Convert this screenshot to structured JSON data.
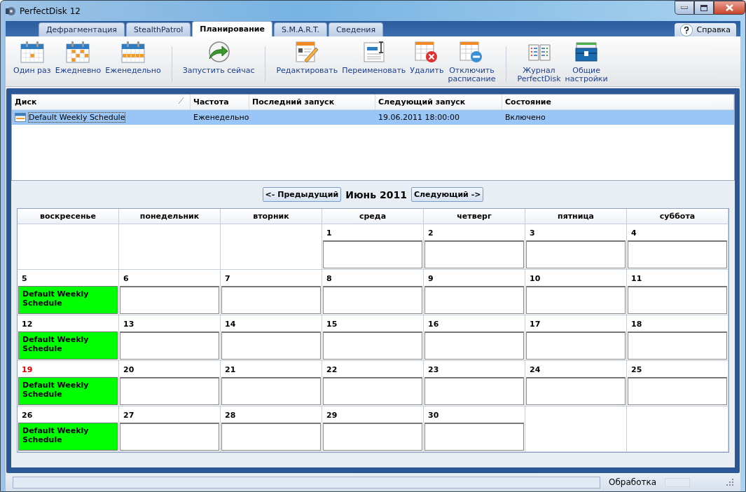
{
  "window": {
    "title": "PerfectDisk 12"
  },
  "tabs": [
    {
      "label": "Дефрагментация",
      "selected": false
    },
    {
      "label": "StealthPatrol",
      "selected": false
    },
    {
      "label": "Планирование",
      "selected": true
    },
    {
      "label": "S.M.A.R.T.",
      "selected": false
    },
    {
      "label": "Сведения",
      "selected": false
    }
  ],
  "help": {
    "label": "Справка"
  },
  "toolbar": [
    [
      {
        "kind": "once",
        "label": "Один раз"
      },
      {
        "kind": "daily",
        "label": "Ежедневно"
      },
      {
        "kind": "weekly",
        "label": "Еженедельно"
      }
    ],
    [
      {
        "kind": "run",
        "label": "Запустить сейчас"
      }
    ],
    [
      {
        "kind": "edit",
        "label": "Редактировать"
      },
      {
        "kind": "rename",
        "label": "Переименовать"
      },
      {
        "kind": "delete",
        "label": "Удалить"
      },
      {
        "kind": "disable",
        "label": "Отключить\nрасписание"
      }
    ],
    [
      {
        "kind": "journal",
        "label": "Журнал\nPerfectDisk"
      },
      {
        "kind": "settings",
        "label": "Общие\nнастройки"
      }
    ]
  ],
  "table": {
    "columns": [
      "Диск",
      "Частота",
      "Последний запуск",
      "Следующий запуск",
      "Состояние"
    ],
    "rows": [
      {
        "selected": true,
        "disk": "Default Weekly Schedule",
        "frequency": "Еженедельно",
        "next_run": "19.06.2011 18:00:00",
        "status": "Включено"
      }
    ]
  },
  "calendar": {
    "prev": "<- Предыдущий",
    "month": "Июнь 2011",
    "next": "Следующий ->",
    "weekdays": [
      "воскресенье",
      "понедельник",
      "вторник",
      "среда",
      "четверг",
      "пятница",
      "суббота"
    ],
    "weeks": [
      [
        {
          "kind": "blank"
        },
        {
          "kind": "blank"
        },
        {
          "kind": "blank"
        },
        {
          "kind": "day",
          "day": "1",
          "today": false
        },
        {
          "kind": "day",
          "day": "2",
          "today": false
        },
        {
          "kind": "day",
          "day": "3",
          "today": false
        },
        {
          "kind": "day",
          "day": "4",
          "today": false
        }
      ],
      [
        {
          "kind": "day",
          "day": "5",
          "today": false,
          "events": [
            "Default Weekly Schedule"
          ]
        },
        {
          "kind": "day",
          "day": "6",
          "today": false
        },
        {
          "kind": "day",
          "day": "7",
          "today": false
        },
        {
          "kind": "day",
          "day": "8",
          "today": false
        },
        {
          "kind": "day",
          "day": "9",
          "today": false
        },
        {
          "kind": "day",
          "day": "10",
          "today": false
        },
        {
          "kind": "day",
          "day": "11",
          "today": false
        }
      ],
      [
        {
          "kind": "day",
          "day": "12",
          "today": false,
          "events": [
            "Default Weekly Schedule"
          ]
        },
        {
          "kind": "day",
          "day": "13",
          "today": false
        },
        {
          "kind": "day",
          "day": "14",
          "today": false
        },
        {
          "kind": "day",
          "day": "15",
          "today": false
        },
        {
          "kind": "day",
          "day": "16",
          "today": false
        },
        {
          "kind": "day",
          "day": "17",
          "today": false
        },
        {
          "kind": "day",
          "day": "18",
          "today": false
        }
      ],
      [
        {
          "kind": "day",
          "day": "19",
          "today": true,
          "events": [
            "Default Weekly Schedule"
          ]
        },
        {
          "kind": "day",
          "day": "20",
          "today": false
        },
        {
          "kind": "day",
          "day": "21",
          "today": false
        },
        {
          "kind": "day",
          "day": "22",
          "today": false
        },
        {
          "kind": "day",
          "day": "23",
          "today": false
        },
        {
          "kind": "day",
          "day": "24",
          "today": false
        },
        {
          "kind": "day",
          "day": "25",
          "today": false
        }
      ],
      [
        {
          "kind": "day",
          "day": "26",
          "today": false,
          "events": [
            "Default Weekly Schedule"
          ]
        },
        {
          "kind": "day",
          "day": "27",
          "today": false
        },
        {
          "kind": "day",
          "day": "28",
          "today": false
        },
        {
          "kind": "day",
          "day": "29",
          "today": false
        },
        {
          "kind": "day",
          "day": "30",
          "today": false
        },
        {
          "kind": "blank"
        },
        {
          "kind": "blank"
        }
      ]
    ]
  },
  "status_bar": {
    "label": "Обработка",
    "progress": {
      "level": 0
    }
  }
}
